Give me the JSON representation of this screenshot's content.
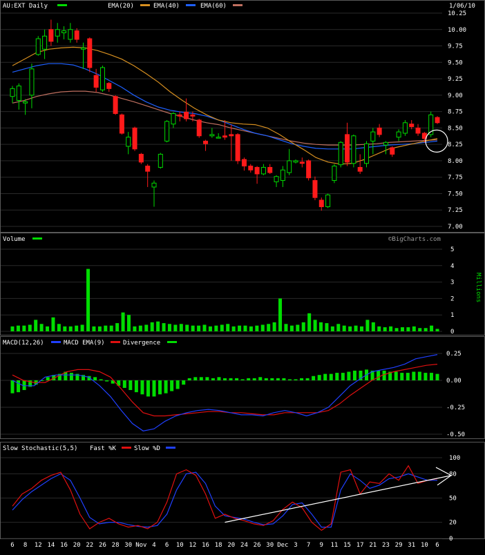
{
  "colors": {
    "background": "#000000",
    "panel_border": "#5a5a5a",
    "grid": "#2a2a2a",
    "text": "#ffffff",
    "up": "#00dd00",
    "down": "#ff1a1a",
    "ema20": "#d89020",
    "ema40": "#1e60ff",
    "ema60": "#c07060",
    "macd": "#2040ff",
    "macd_ema": "#e01010",
    "histogram": "#00dd00",
    "fast_k": "#e01010",
    "slow_d": "#2040ff",
    "annotation": "#ffffff"
  },
  "price_panel": {
    "legend": [
      "AU:EXT Daily",
      "EMA(20)",
      "EMA(40)",
      "EMA(60)"
    ],
    "date": "1/06/10",
    "ticks": [
      "10.25",
      "10.00",
      "9.75",
      "9.50",
      "9.25",
      "9.00",
      "8.75",
      "8.50",
      "8.25",
      "8.00",
      "7.75",
      "7.50",
      "7.25",
      "7.00"
    ]
  },
  "volume_panel": {
    "title": "Volume",
    "brand": "©BigCharts.com",
    "ticks": [
      "5",
      "4",
      "3",
      "2",
      "1",
      "0"
    ],
    "unit": "Millions"
  },
  "macd_panel": {
    "legend": [
      "MACD(12,26)",
      "MACD EMA(9)",
      "Divergence"
    ],
    "ticks": [
      "0.25",
      "0.00",
      "-0.25",
      "-0.50"
    ]
  },
  "stoch_panel": {
    "legend": [
      "Slow Stochastic(5,5)",
      "Fast %K",
      "Slow %D"
    ],
    "ticks": [
      "100",
      "80",
      "50",
      "20",
      "0"
    ]
  },
  "x_axis": {
    "labels": [
      "6",
      "8",
      "12",
      "14",
      "16",
      "20",
      "22",
      "26",
      "28",
      "30",
      "Nov",
      "4",
      "6",
      "10",
      "12",
      "16",
      "18",
      "20",
      "24",
      "26",
      "30",
      "Dec",
      "3",
      "7",
      "9",
      "11",
      "15",
      "17",
      "21",
      "23",
      "29",
      "31",
      "10",
      "6"
    ]
  },
  "chart_data": [
    {
      "type": "candlestick",
      "title": "AU:EXT Daily",
      "ylim": [
        7.0,
        10.25
      ],
      "series_names": [
        "EMA(20)",
        "EMA(40)",
        "EMA(60)"
      ],
      "candles": [
        {
          "o": 8.98,
          "h": 9.14,
          "l": 8.88,
          "c": 9.1
        },
        {
          "o": 8.92,
          "h": 9.18,
          "l": 8.78,
          "c": 9.14
        },
        {
          "o": 8.88,
          "h": 8.94,
          "l": 8.7,
          "c": 8.9
        },
        {
          "o": 9.0,
          "h": 9.48,
          "l": 8.8,
          "c": 9.4
        },
        {
          "o": 9.62,
          "h": 9.9,
          "l": 9.6,
          "c": 9.86
        },
        {
          "o": 9.7,
          "h": 10.0,
          "l": 9.55,
          "c": 9.9
        },
        {
          "o": 10.0,
          "h": 10.15,
          "l": 9.75,
          "c": 9.82
        },
        {
          "o": 9.9,
          "h": 10.1,
          "l": 9.8,
          "c": 10.0
        },
        {
          "o": 9.95,
          "h": 10.05,
          "l": 9.85,
          "c": 9.98
        },
        {
          "o": 9.85,
          "h": 10.1,
          "l": 9.8,
          "c": 10.0
        },
        {
          "o": 9.98,
          "h": 10.02,
          "l": 9.8,
          "c": 9.85
        },
        {
          "o": 9.7,
          "h": 9.8,
          "l": 9.4,
          "c": 9.72
        },
        {
          "o": 9.86,
          "h": 9.88,
          "l": 9.35,
          "c": 9.42
        },
        {
          "o": 9.3,
          "h": 9.4,
          "l": 9.05,
          "c": 9.12
        },
        {
          "o": 9.08,
          "h": 9.45,
          "l": 9.05,
          "c": 9.42
        },
        {
          "o": 9.18,
          "h": 9.2,
          "l": 9.05,
          "c": 9.1
        },
        {
          "o": 8.98,
          "h": 9.0,
          "l": 8.7,
          "c": 8.72
        },
        {
          "o": 8.7,
          "h": 8.72,
          "l": 8.4,
          "c": 8.42
        },
        {
          "o": 8.22,
          "h": 8.44,
          "l": 8.1,
          "c": 8.36
        },
        {
          "o": 8.5,
          "h": 8.52,
          "l": 8.15,
          "c": 8.18
        },
        {
          "o": 8.1,
          "h": 8.12,
          "l": 7.95,
          "c": 7.98
        },
        {
          "o": 7.92,
          "h": 7.95,
          "l": 7.6,
          "c": 7.84
        },
        {
          "o": 7.6,
          "h": 7.7,
          "l": 7.3,
          "c": 7.66
        },
        {
          "o": 7.9,
          "h": 8.12,
          "l": 7.88,
          "c": 8.1
        },
        {
          "o": 8.3,
          "h": 8.62,
          "l": 8.28,
          "c": 8.6
        },
        {
          "o": 8.56,
          "h": 8.74,
          "l": 8.5,
          "c": 8.72
        },
        {
          "o": 8.7,
          "h": 8.75,
          "l": 8.6,
          "c": 8.68
        },
        {
          "o": 8.74,
          "h": 8.95,
          "l": 8.6,
          "c": 8.64
        },
        {
          "o": 8.7,
          "h": 8.75,
          "l": 8.6,
          "c": 8.68
        },
        {
          "o": 8.62,
          "h": 8.64,
          "l": 8.35,
          "c": 8.38
        },
        {
          "o": 8.3,
          "h": 8.32,
          "l": 8.15,
          "c": 8.26
        },
        {
          "o": 8.38,
          "h": 8.5,
          "l": 8.35,
          "c": 8.4
        },
        {
          "o": 8.36,
          "h": 8.42,
          "l": 8.34,
          "c": 8.36
        },
        {
          "o": 8.38,
          "h": 8.62,
          "l": 8.32,
          "c": 8.36
        },
        {
          "o": 8.4,
          "h": 8.55,
          "l": 8.0,
          "c": 8.38
        },
        {
          "o": 8.4,
          "h": 8.42,
          "l": 7.95,
          "c": 8.0
        },
        {
          "o": 8.02,
          "h": 8.05,
          "l": 7.85,
          "c": 7.92
        },
        {
          "o": 7.92,
          "h": 7.95,
          "l": 7.82,
          "c": 7.86
        },
        {
          "o": 7.9,
          "h": 7.92,
          "l": 7.65,
          "c": 7.8
        },
        {
          "o": 7.8,
          "h": 7.95,
          "l": 7.78,
          "c": 7.9
        },
        {
          "o": 7.9,
          "h": 7.95,
          "l": 7.8,
          "c": 7.82
        },
        {
          "o": 7.68,
          "h": 7.78,
          "l": 7.6,
          "c": 7.76
        },
        {
          "o": 7.7,
          "h": 7.92,
          "l": 7.6,
          "c": 7.86
        },
        {
          "o": 7.82,
          "h": 8.18,
          "l": 7.78,
          "c": 8.0
        },
        {
          "o": 7.98,
          "h": 8.02,
          "l": 7.96,
          "c": 8.0
        },
        {
          "o": 7.98,
          "h": 8.05,
          "l": 7.9,
          "c": 7.96
        },
        {
          "o": 8.0,
          "h": 8.02,
          "l": 7.7,
          "c": 7.74
        },
        {
          "o": 7.7,
          "h": 7.76,
          "l": 7.4,
          "c": 7.44
        },
        {
          "o": 7.4,
          "h": 7.44,
          "l": 7.24,
          "c": 7.3
        },
        {
          "o": 7.3,
          "h": 7.5,
          "l": 7.28,
          "c": 7.48
        },
        {
          "o": 7.7,
          "h": 7.95,
          "l": 7.66,
          "c": 7.92
        },
        {
          "o": 7.94,
          "h": 8.3,
          "l": 7.9,
          "c": 8.28
        },
        {
          "o": 8.4,
          "h": 8.58,
          "l": 7.92,
          "c": 7.98
        },
        {
          "o": 7.96,
          "h": 8.4,
          "l": 7.9,
          "c": 8.38
        },
        {
          "o": 7.9,
          "h": 8.1,
          "l": 7.8,
          "c": 7.84
        },
        {
          "o": 7.96,
          "h": 8.3,
          "l": 7.9,
          "c": 8.26
        },
        {
          "o": 8.3,
          "h": 8.5,
          "l": 8.1,
          "c": 8.44
        },
        {
          "o": 8.5,
          "h": 8.56,
          "l": 8.36,
          "c": 8.4
        },
        {
          "o": 8.24,
          "h": 8.3,
          "l": 8.1,
          "c": 8.28
        },
        {
          "o": 8.2,
          "h": 8.22,
          "l": 8.06,
          "c": 8.1
        },
        {
          "o": 8.36,
          "h": 8.48,
          "l": 8.3,
          "c": 8.44
        },
        {
          "o": 8.42,
          "h": 8.62,
          "l": 8.38,
          "c": 8.58
        },
        {
          "o": 8.56,
          "h": 8.62,
          "l": 8.48,
          "c": 8.52
        },
        {
          "o": 8.5,
          "h": 8.56,
          "l": 8.38,
          "c": 8.42
        },
        {
          "o": 8.42,
          "h": 8.44,
          "l": 8.28,
          "c": 8.34
        },
        {
          "o": 8.4,
          "h": 8.75,
          "l": 8.36,
          "c": 8.7
        },
        {
          "o": 8.66,
          "h": 8.68,
          "l": 8.56,
          "c": 8.58
        }
      ],
      "ema20": [
        9.45,
        9.55,
        9.65,
        9.7,
        9.72,
        9.73,
        9.72,
        9.68,
        9.62,
        9.55,
        9.45,
        9.33,
        9.2,
        9.05,
        8.92,
        8.8,
        8.7,
        8.62,
        8.58,
        8.56,
        8.55,
        8.5,
        8.4,
        8.28,
        8.17,
        8.05,
        7.98,
        7.95,
        7.96,
        8.02,
        8.1,
        8.18,
        8.22,
        8.26,
        8.3,
        8.34
      ],
      "ema40": [
        9.35,
        9.4,
        9.45,
        9.48,
        9.48,
        9.46,
        9.4,
        9.32,
        9.22,
        9.12,
        9.0,
        8.9,
        8.82,
        8.77,
        8.74,
        8.72,
        8.68,
        8.62,
        8.55,
        8.48,
        8.42,
        8.38,
        8.32,
        8.26,
        8.22,
        8.19,
        8.18,
        8.18,
        8.18,
        8.2,
        8.22,
        8.24,
        8.25,
        8.26,
        8.28,
        8.3
      ],
      "ema60": [
        8.88,
        8.92,
        8.98,
        9.02,
        9.05,
        9.06,
        9.06,
        9.04,
        9.0,
        8.95,
        8.9,
        8.84,
        8.78,
        8.72,
        8.67,
        8.62,
        8.58,
        8.55,
        8.5,
        8.46,
        8.42,
        8.38,
        8.34,
        8.3,
        8.27,
        8.25,
        8.24,
        8.24,
        8.24,
        8.25,
        8.26,
        8.28,
        8.29,
        8.3,
        8.31,
        8.32
      ]
    },
    {
      "type": "bar",
      "title": "Volume",
      "ylabel": "Millions",
      "ylim": [
        0,
        5
      ],
      "values": [
        0.3,
        0.35,
        0.35,
        0.4,
        0.7,
        0.45,
        0.3,
        0.85,
        0.45,
        0.3,
        0.3,
        0.35,
        0.4,
        3.8,
        0.3,
        0.3,
        0.35,
        0.35,
        0.5,
        1.15,
        1.0,
        0.3,
        0.35,
        0.4,
        0.55,
        0.6,
        0.5,
        0.45,
        0.4,
        0.45,
        0.4,
        0.35,
        0.35,
        0.4,
        0.3,
        0.35,
        0.4,
        0.45,
        0.3,
        0.35,
        0.35,
        0.3,
        0.35,
        0.4,
        0.45,
        0.55,
        2.0,
        0.45,
        0.35,
        0.4,
        0.55,
        1.1,
        0.7,
        0.55,
        0.5,
        0.3,
        0.45,
        0.35,
        0.3,
        0.35,
        0.3,
        0.7,
        0.55,
        0.3,
        0.25,
        0.3,
        0.2,
        0.25,
        0.25,
        0.3,
        0.2,
        0.2,
        0.35,
        0.15
      ]
    },
    {
      "type": "line",
      "title": "MACD(12,26)",
      "ylim": [
        -0.5,
        0.25
      ],
      "series_names": [
        "MACD EMA(9)",
        "Divergence"
      ],
      "macd": [
        0.0,
        -0.05,
        -0.05,
        0.03,
        0.05,
        0.05,
        0.05,
        0.03,
        -0.05,
        -0.15,
        -0.28,
        -0.4,
        -0.47,
        -0.45,
        -0.38,
        -0.33,
        -0.3,
        -0.28,
        -0.27,
        -0.28,
        -0.3,
        -0.32,
        -0.32,
        -0.33,
        -0.3,
        -0.28,
        -0.3,
        -0.33,
        -0.3,
        -0.25,
        -0.15,
        -0.05,
        0.02,
        0.08,
        0.1,
        0.12,
        0.15,
        0.2,
        0.22,
        0.24
      ],
      "signal": [
        0.05,
        0.0,
        -0.02,
        -0.02,
        0.03,
        0.08,
        0.1,
        0.1,
        0.08,
        0.03,
        -0.08,
        -0.2,
        -0.3,
        -0.33,
        -0.33,
        -0.32,
        -0.31,
        -0.3,
        -0.29,
        -0.29,
        -0.3,
        -0.3,
        -0.31,
        -0.32,
        -0.32,
        -0.3,
        -0.3,
        -0.3,
        -0.3,
        -0.28,
        -0.22,
        -0.14,
        -0.07,
        0.0,
        0.05,
        0.08,
        0.1,
        0.12,
        0.14,
        0.15
      ],
      "divergence": [
        -0.12,
        -0.11,
        -0.09,
        -0.06,
        -0.04,
        0.0,
        0.03,
        0.05,
        0.06,
        0.08,
        0.07,
        0.06,
        0.05,
        0.04,
        0.03,
        0.01,
        -0.01,
        -0.03,
        -0.05,
        -0.07,
        -0.09,
        -0.11,
        -0.13,
        -0.15,
        -0.15,
        -0.13,
        -0.12,
        -0.1,
        -0.08,
        -0.04,
        0.02,
        0.03,
        0.03,
        0.03,
        0.02,
        0.03,
        0.02,
        0.02,
        0.02,
        0.01,
        0.02,
        0.02,
        0.03,
        0.02,
        0.02,
        0.02,
        0.02,
        0.01,
        0.01,
        0.02,
        0.02,
        0.04,
        0.05,
        0.06,
        0.06,
        0.07,
        0.07,
        0.08,
        0.09,
        0.09,
        0.1,
        0.09,
        0.09,
        0.09,
        0.08,
        0.08,
        0.07,
        0.07,
        0.08,
        0.08,
        0.07,
        0.07,
        0.06
      ]
    },
    {
      "type": "line",
      "title": "Slow Stochastic(5,5)",
      "ylim": [
        0,
        100
      ],
      "series_names": [
        "Fast %K",
        "Slow %D"
      ],
      "fast_k": [
        40,
        55,
        62,
        72,
        78,
        82,
        60,
        30,
        12,
        20,
        25,
        18,
        14,
        16,
        12,
        20,
        45,
        80,
        85,
        78,
        55,
        25,
        30,
        25,
        22,
        18,
        16,
        22,
        36,
        45,
        38,
        20,
        10,
        18,
        82,
        85,
        55,
        70,
        68,
        80,
        72,
        90,
        68,
        72,
        74
      ],
      "slow_d": [
        35,
        48,
        58,
        66,
        74,
        80,
        72,
        50,
        26,
        18,
        20,
        20,
        17,
        15,
        14,
        16,
        30,
        60,
        80,
        82,
        68,
        40,
        28,
        26,
        24,
        20,
        17,
        18,
        28,
        42,
        44,
        30,
        14,
        14,
        60,
        80,
        72,
        62,
        66,
        74,
        76,
        80,
        76,
        72,
        72
      ],
      "trendline": {
        "start": [
          22,
          20
        ],
        "end": [
          44,
          78
        ]
      }
    }
  ]
}
